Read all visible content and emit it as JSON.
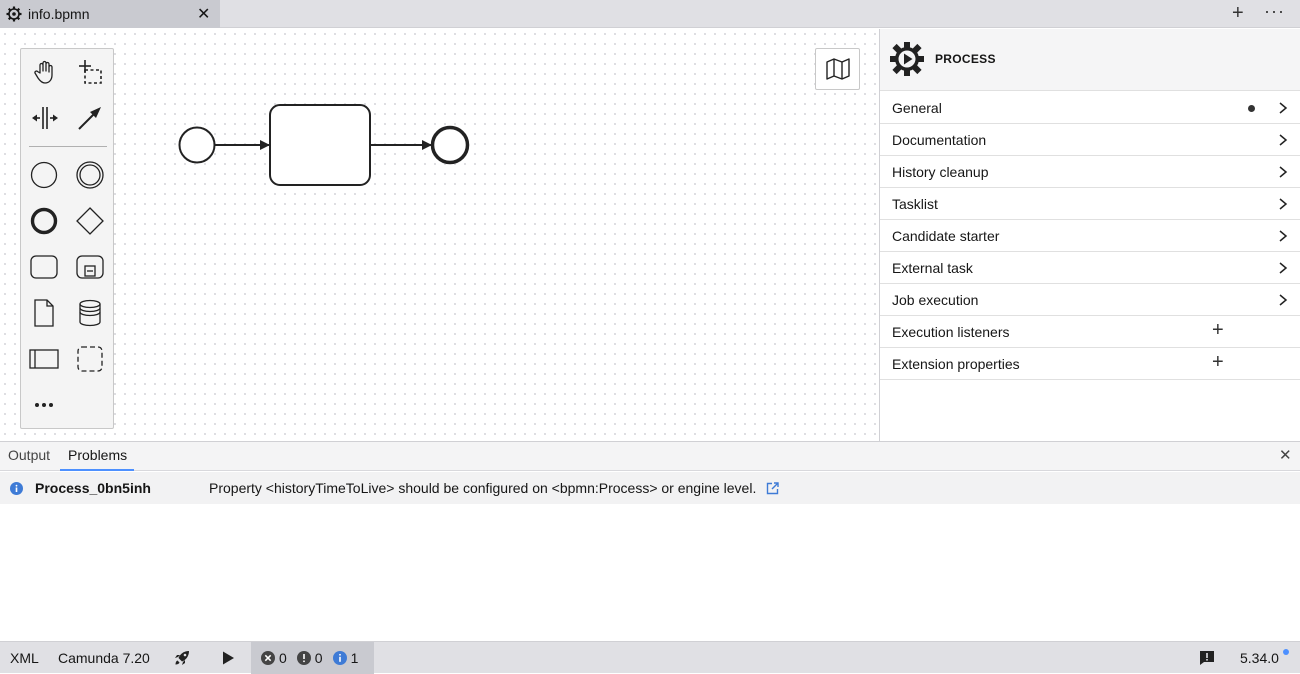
{
  "tab": {
    "title": "info.bpmn"
  },
  "palette": {
    "tools": [
      "hand-tool",
      "lasso-tool",
      "space-tool",
      "connect-tool",
      "start-event",
      "intermediate-event",
      "end-event",
      "gateway",
      "task",
      "subprocess",
      "data-object",
      "data-store",
      "pool",
      "group",
      "more"
    ]
  },
  "properties": {
    "title": "PROCESS",
    "groups": [
      {
        "label": "General"
      },
      {
        "label": "Documentation"
      },
      {
        "label": "History cleanup"
      },
      {
        "label": "Tasklist"
      },
      {
        "label": "Candidate starter"
      },
      {
        "label": "External task"
      },
      {
        "label": "Job execution"
      },
      {
        "label": "Execution listeners"
      },
      {
        "label": "Extension properties"
      }
    ]
  },
  "bottom": {
    "tabs": [
      "Output",
      "Problems"
    ],
    "problem": {
      "id": "Process_0bn5inh",
      "message": "Property <historyTimeToLive> should be configured on <bpmn:Process> or engine level."
    }
  },
  "status": {
    "xml": "XML",
    "engine": "Camunda 7.20",
    "errors": "0",
    "warnings": "0",
    "infos": "1",
    "version": "5.34.0"
  },
  "colors": {
    "accent": "#4d90ff",
    "info": "#3e7bd6"
  }
}
